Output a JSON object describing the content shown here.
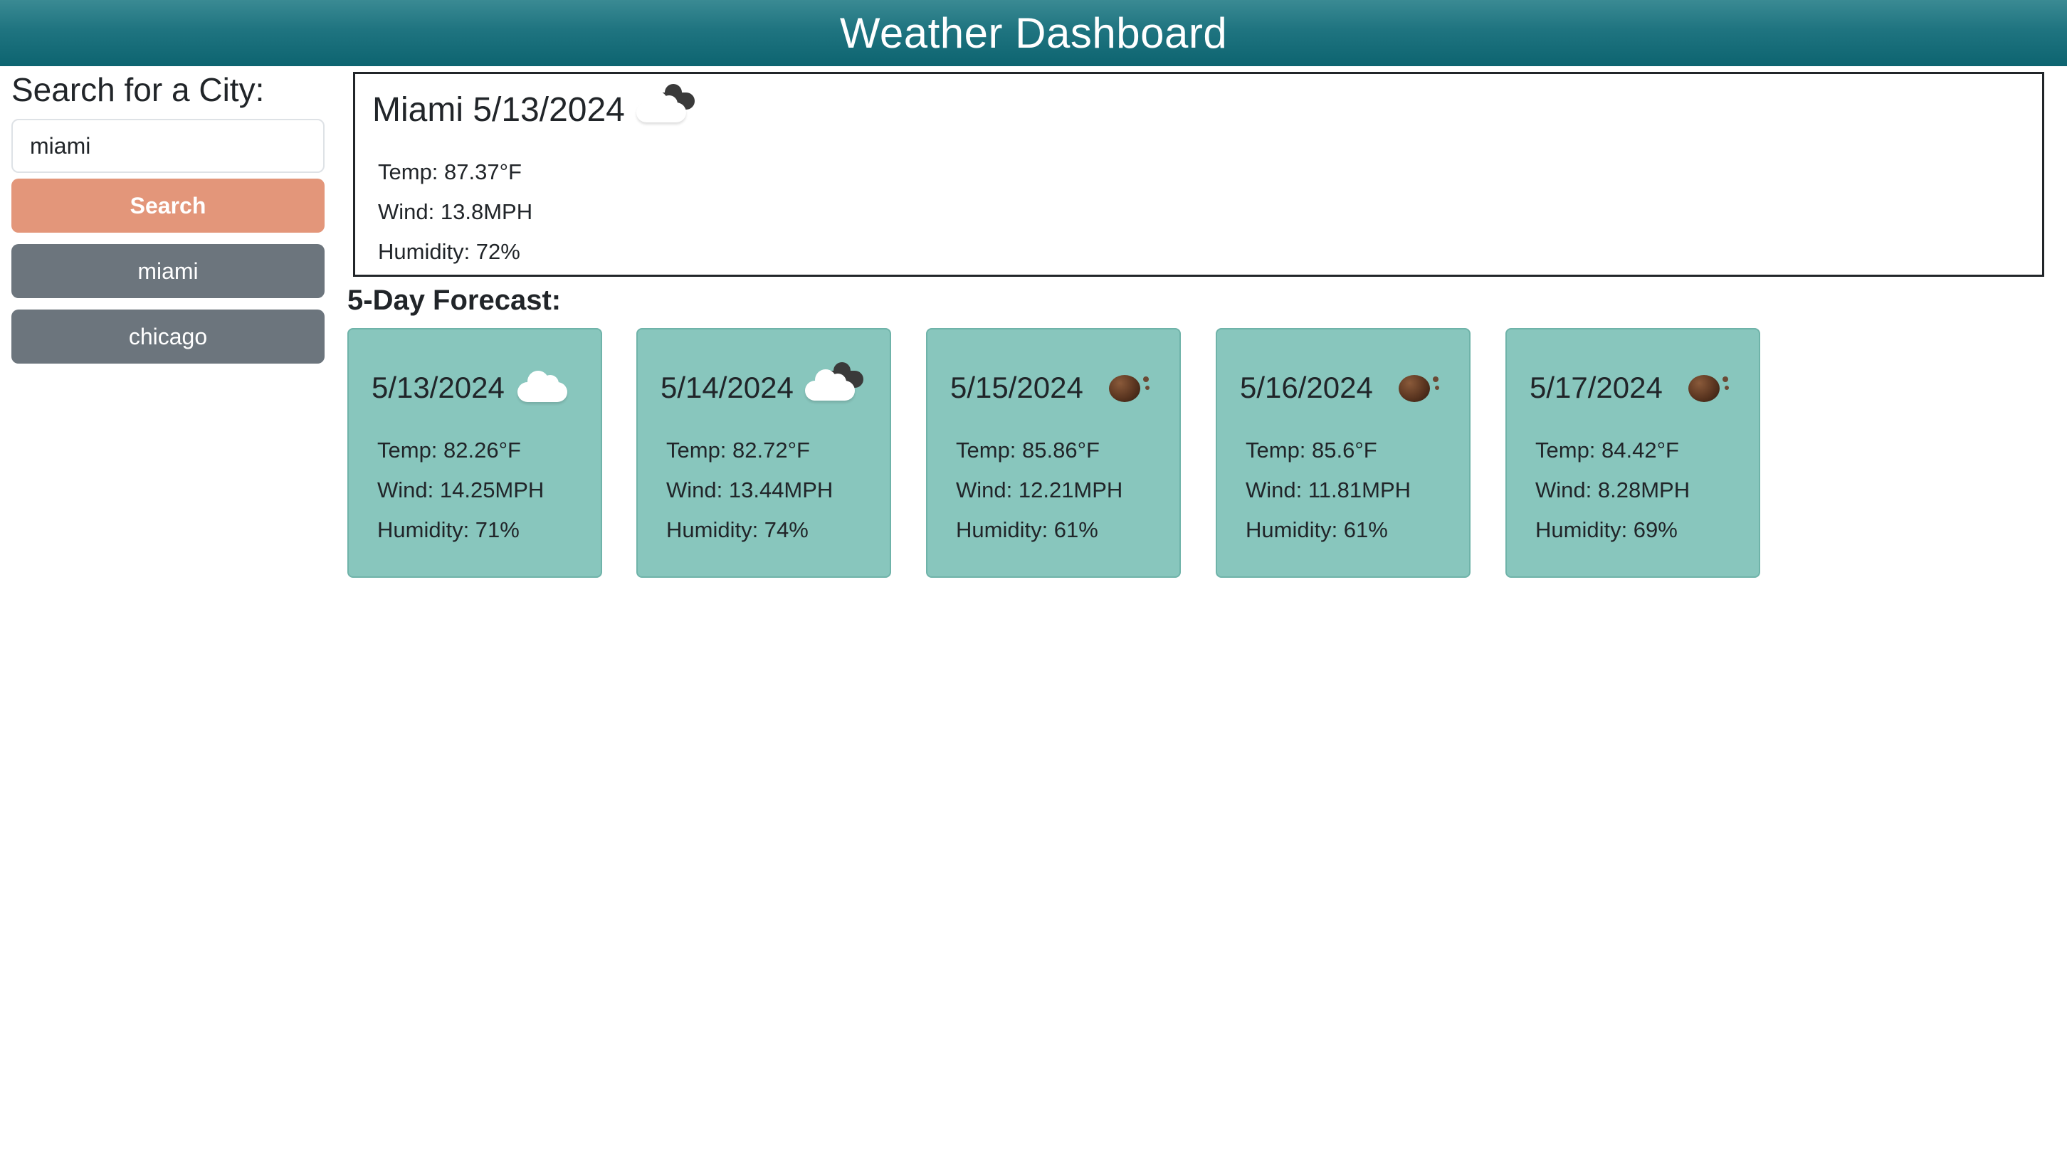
{
  "header": {
    "title": "Weather Dashboard"
  },
  "sidebar": {
    "heading": "Search for a City:",
    "search_value": "miami",
    "search_button": "Search",
    "history": [
      "miami",
      "chicago"
    ]
  },
  "current": {
    "title": "Miami 5/13/2024",
    "icon": "partly-cloudy-icon",
    "temp": "Temp: 87.37°F",
    "wind": "Wind: 13.8MPH",
    "humidity": "Humidity: 72%"
  },
  "forecast": {
    "heading": "5-Day Forecast:",
    "days": [
      {
        "date": "5/13/2024",
        "icon": "cloud-icon",
        "temp": "Temp: 82.26°F",
        "wind": "Wind: 14.25MPH",
        "humidity": "Humidity: 71%"
      },
      {
        "date": "5/14/2024",
        "icon": "partly-cloudy-icon",
        "temp": "Temp: 82.72°F",
        "wind": "Wind: 13.44MPH",
        "humidity": "Humidity: 74%"
      },
      {
        "date": "5/15/2024",
        "icon": "clear-icon",
        "temp": "Temp: 85.86°F",
        "wind": "Wind: 12.21MPH",
        "humidity": "Humidity: 61%"
      },
      {
        "date": "5/16/2024",
        "icon": "clear-icon",
        "temp": "Temp: 85.6°F",
        "wind": "Wind: 11.81MPH",
        "humidity": "Humidity: 61%"
      },
      {
        "date": "5/17/2024",
        "icon": "clear-icon",
        "temp": "Temp: 84.42°F",
        "wind": "Wind: 8.28MPH",
        "humidity": "Humidity: 69%"
      }
    ]
  },
  "colors": {
    "header_gradient_top": "#3a8a93",
    "header_gradient_bottom": "#0d6470",
    "search_button": "#e3967a",
    "history_button": "#6c757d",
    "forecast_card": "#88c6bd"
  }
}
